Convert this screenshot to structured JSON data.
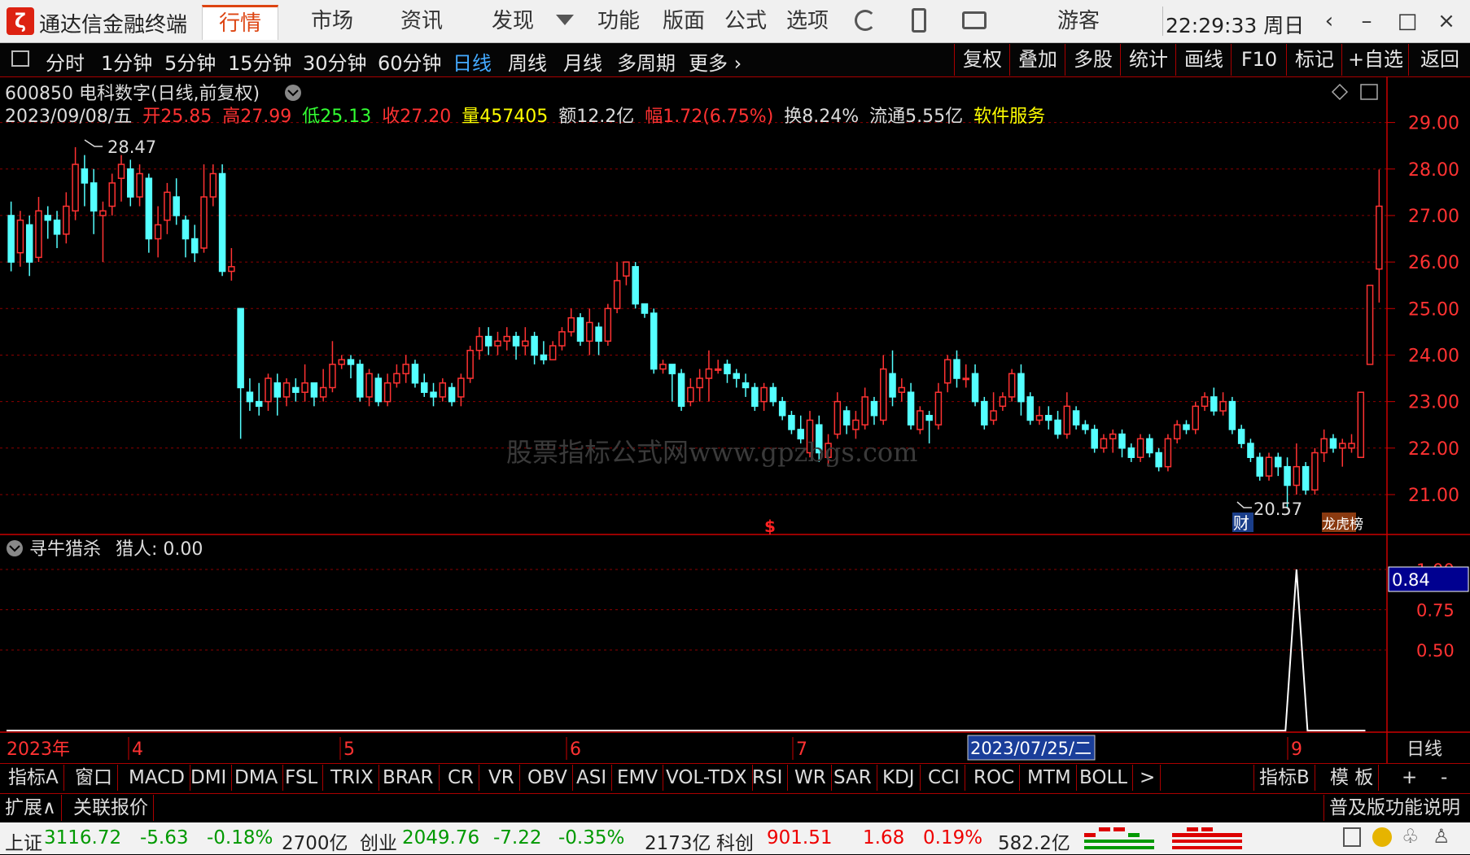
{
  "app": {
    "name": "通达信金融终端",
    "logo_text": "ζ"
  },
  "nav": {
    "tabs": [
      "行情",
      "市场",
      "资讯",
      "发现",
      "功能",
      "版面",
      "公式",
      "选项"
    ],
    "user": "游客",
    "clock": "22:29:33 周日"
  },
  "periods": [
    "分时",
    "1分钟",
    "5分钟",
    "15分钟",
    "30分钟",
    "60分钟",
    "日线",
    "周线",
    "月线",
    "多周期",
    "更多 ›"
  ],
  "tools": [
    "复权",
    "叠加",
    "多股",
    "统计",
    "画线",
    "F10",
    "标记",
    "+自选",
    "返回"
  ],
  "stock": {
    "title": "600850 电科数字(日线,前复权)",
    "date": "2023/09/08/五",
    "open_label": "开",
    "open": "25.85",
    "high_label": "高",
    "high": "27.99",
    "low_label": "低",
    "low": "25.13",
    "close_label": "收",
    "close": "27.20",
    "vol_label": "量",
    "vol": "457405",
    "amount": "额12.2亿",
    "change_label": "幅",
    "change": "1.72(6.75%)",
    "turnover": "换8.24%",
    "float": "流通5.55亿",
    "industry": "软件服务"
  },
  "watermark": "股票指标公式网www.gpzbgs.com",
  "price_axis": [
    "29.00",
    "28.00",
    "27.00",
    "26.00",
    "25.00",
    "24.00",
    "23.00",
    "22.00",
    "21.00"
  ],
  "annotations": {
    "high_mark": "28.47",
    "low_mark": "20.57",
    "cai": "财",
    "longhu": "龙虎榜",
    "dollar": "$"
  },
  "indicator": {
    "title": "寻牛猎杀",
    "line_label": "猎人: 0.00",
    "axis": [
      "1.00",
      "0.75",
      "0.50"
    ],
    "current": "0.84"
  },
  "dates": {
    "year": "2023年",
    "m4": "4",
    "m5": "5",
    "m6": "6",
    "m7": "7",
    "m9": "9",
    "cursor": "2023/07/25/二",
    "period": "日线"
  },
  "indicators": [
    "指标A",
    "窗口",
    "MACD",
    "DMI",
    "DMA",
    "FSL",
    "TRIX",
    "BRAR",
    "CR",
    "VR",
    "OBV",
    "ASI",
    "EMV",
    "VOL-TDX",
    "RSI",
    "WR",
    "SAR",
    "KDJ",
    "CCI",
    "ROC",
    "MTM",
    "BOLL",
    ">"
  ],
  "indicators_right": [
    "指标B",
    "模 板",
    "+",
    "-"
  ],
  "ext": {
    "expand": "扩展∧",
    "related": "关联报价",
    "help": "普及版功能说明"
  },
  "status": {
    "sh_label": "上证",
    "sh_val": "3116.72",
    "sh_chg": "-5.63",
    "sh_pct": "-0.18%",
    "sh_amt": "2700亿",
    "cy_label": "创业",
    "cy_val": "2049.76",
    "cy_chg": "-7.22",
    "cy_pct": "-0.35%",
    "cy_amt": "2173亿",
    "kc_label": "科创",
    "kc_val": "901.51",
    "kc_chg": "1.68",
    "kc_pct": "0.19%",
    "kc_amt": "582.2亿"
  },
  "colors": {
    "up": "#ff3232",
    "down": "#54ffff",
    "grid": "#8b0000",
    "axis": "#ff3232"
  },
  "chart_data": {
    "type": "candlestick",
    "y_range": [
      20.3,
      29.5
    ],
    "candles": [
      [
        21.9,
        22.6,
        21.8,
        22.8
      ],
      [
        22.5,
        21.9,
        21.7,
        22.7
      ],
      [
        21.8,
        22.1,
        21.6,
        22.3
      ],
      [
        22.3,
        23.0,
        22.2,
        23.2
      ],
      [
        22.8,
        22.5,
        22.3,
        22.9
      ],
      [
        22.4,
        22.6,
        22.2,
        22.8
      ],
      [
        22.5,
        23.1,
        22.4,
        23.3
      ],
      [
        23.0,
        22.7,
        22.5,
        23.1
      ],
      [
        22.6,
        23.7,
        22.5,
        24.0
      ],
      [
        23.6,
        23.1,
        22.9,
        24.1
      ],
      [
        23.2,
        23.3,
        23.0,
        23.5
      ],
      [
        23.2,
        22.5,
        22.4,
        23.4
      ],
      [
        22.4,
        22.8,
        22.3,
        22.9
      ],
      [
        22.7,
        22.6,
        22.1,
        22.8
      ],
      [
        22.5,
        23.2,
        22.4,
        23.4
      ],
      [
        23.4,
        23.9,
        23.2,
        24.0
      ],
      [
        23.9,
        23.5,
        23.3,
        24.1
      ],
      [
        23.5,
        23.5,
        23.3,
        23.8
      ],
      [
        23.6,
        23.0,
        22.9,
        23.8
      ],
      [
        23.0,
        22.5,
        22.4,
        23.1
      ],
      [
        22.6,
        22.8,
        22.5,
        23.2
      ],
      [
        22.9,
        23.1,
        22.8,
        23.2
      ],
      [
        23.1,
        23.6,
        23.0,
        23.7
      ],
      [
        23.6,
        23.0,
        22.7,
        23.8
      ],
      [
        23.1,
        22.6,
        22.5,
        23.2
      ],
      [
        22.6,
        22.7,
        22.5,
        22.9
      ],
      [
        22.7,
        22.6,
        22.4,
        22.9
      ],
      [
        22.6,
        22.3,
        22.2,
        22.8
      ],
      [
        22.3,
        22.9,
        22.2,
        23.2
      ],
      [
        22.8,
        22.5,
        22.4,
        22.9
      ],
      [
        22.5,
        22.4,
        22.3,
        22.6
      ],
      [
        22.4,
        22.0,
        21.9,
        22.5
      ],
      [
        22.0,
        22.2,
        21.9,
        22.3
      ],
      [
        22.2,
        22.3,
        21.9,
        22.4
      ],
      [
        22.3,
        22.0,
        21.8,
        22.4
      ],
      [
        22.0,
        21.8,
        21.7,
        22.1
      ],
      [
        21.8,
        22.2,
        21.7,
        22.3
      ],
      [
        22.2,
        21.9,
        21.8,
        22.3
      ],
      [
        21.9,
        21.6,
        21.5,
        22.0
      ],
      [
        21.6,
        22.2,
        21.5,
        22.3
      ],
      [
        22.2,
        22.5,
        22.1,
        22.6
      ],
      [
        22.5,
        22.4,
        22.3,
        22.6
      ],
      [
        22.4,
        22.9,
        22.3,
        23.0
      ],
      [
        22.9,
        23.1,
        22.8,
        23.2
      ],
      [
        23.1,
        22.8,
        22.7,
        23.3
      ],
      [
        22.8,
        23.0,
        22.7,
        23.2
      ],
      [
        23.0,
        22.4,
        22.3,
        23.1
      ],
      [
        22.4,
        22.1,
        22.0,
        22.5
      ],
      [
        22.1,
        21.8,
        21.7,
        22.2
      ],
      [
        21.8,
        21.4,
        21.3,
        21.9
      ],
      [
        21.4,
        21.8,
        21.3,
        21.9
      ],
      [
        21.8,
        21.6,
        21.4,
        21.9
      ],
      [
        21.6,
        21.2,
        20.7,
        21.8
      ],
      [
        21.2,
        21.6,
        21.0,
        22.1
      ],
      [
        21.6,
        21.1,
        21.0,
        21.7
      ],
      [
        21.1,
        21.9,
        21.0,
        22.0
      ],
      [
        21.9,
        22.2,
        21.7,
        22.4
      ],
      [
        22.2,
        22.0,
        21.9,
        22.3
      ],
      [
        22.0,
        22.1,
        21.6,
        22.2
      ],
      [
        22.0,
        22.1,
        21.9,
        22.3
      ],
      [
        21.8,
        23.2,
        21.8,
        23.2
      ],
      [
        23.8,
        25.5,
        23.8,
        24.0
      ],
      [
        25.85,
        27.2,
        25.13,
        27.99
      ]
    ],
    "indicator_peak": 1.0
  }
}
